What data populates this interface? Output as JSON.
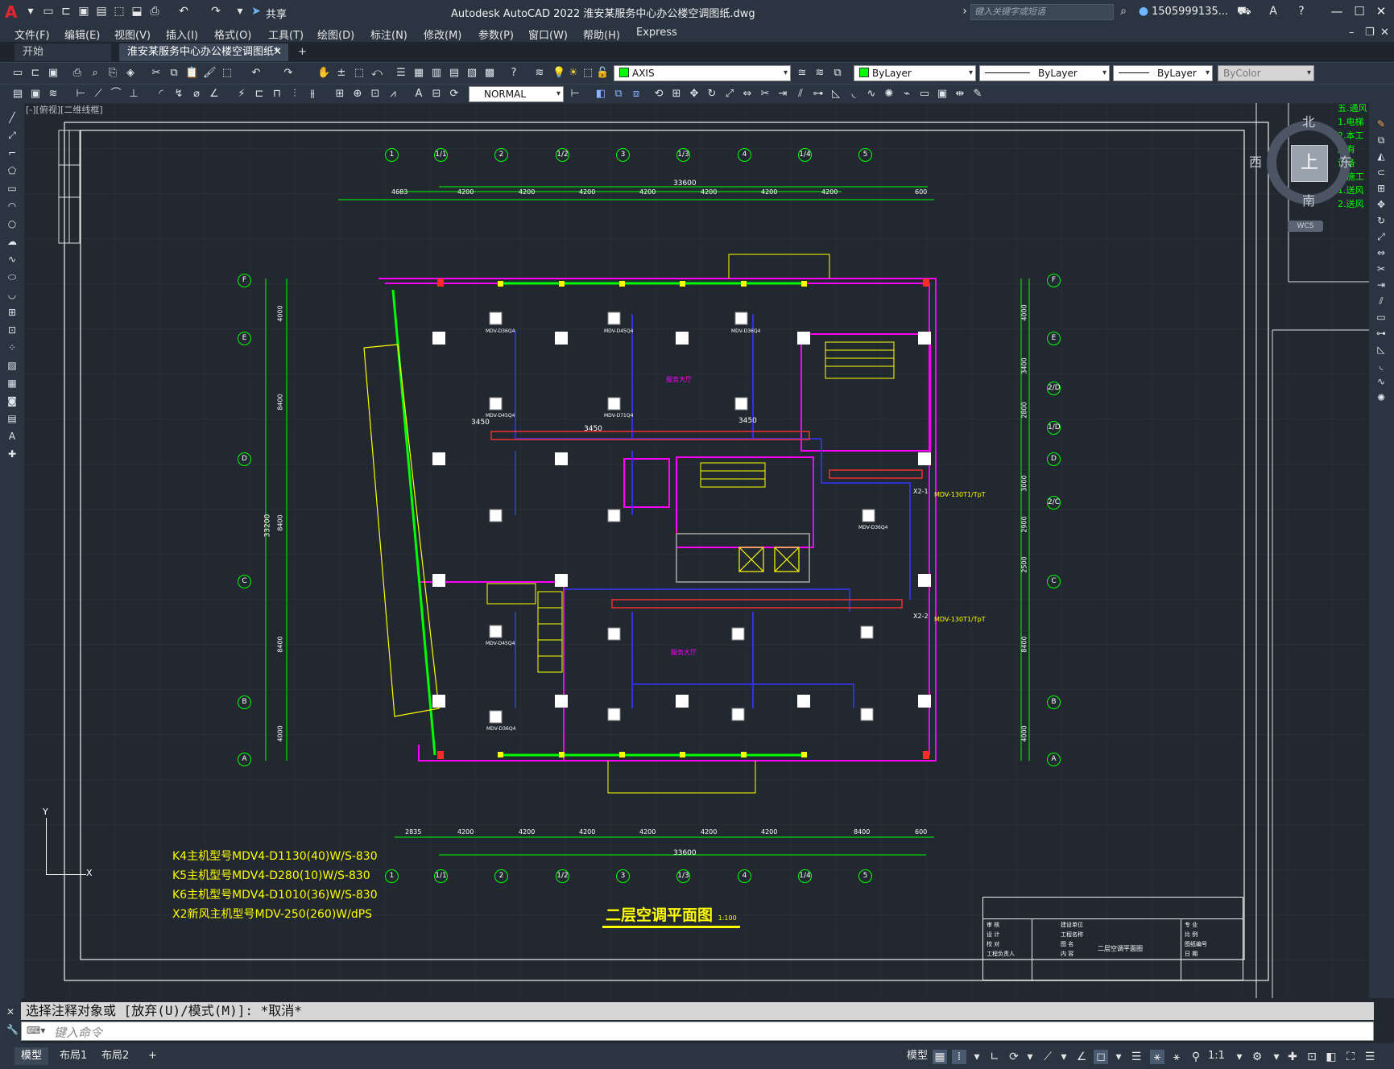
{
  "titlebar": {
    "app_letter": "A",
    "title": "Autodesk AutoCAD 2022    淮安某服务中心办公楼空调图纸.dwg",
    "share_label": "共享",
    "search_placeholder": "键入关键字或短语",
    "user": "1505999135...",
    "minimize": "—",
    "maximize": "☐",
    "close": "✕"
  },
  "menu": [
    "文件(F)",
    "编辑(E)",
    "视图(V)",
    "插入(I)",
    "格式(O)",
    "工具(T)",
    "绘图(D)",
    "标注(N)",
    "修改(M)",
    "参数(P)",
    "窗口(W)",
    "帮助(H)",
    "Express"
  ],
  "tabs": {
    "start": "开始",
    "active": "淮安某服务中心办公楼空调图纸*",
    "close": "✕",
    "add": "+"
  },
  "toolbar": {
    "layer": "AXIS",
    "color": "ByLayer",
    "linetype": "ByLayer",
    "lineweight": "ByLayer",
    "plotstyle": "ByColor",
    "dimstyle": "NORMAL"
  },
  "viewport_label": "[-][俯视][二维线框]",
  "drawing": {
    "grid_top": [
      "1",
      "1/1",
      "2",
      "1/2",
      "3",
      "1/3",
      "4",
      "1/4",
      "5"
    ],
    "grid_side_left": [
      "F",
      "E",
      "D",
      "C",
      "B",
      "A"
    ],
    "grid_side_right": [
      "F",
      "E",
      "2/D",
      "1/D",
      "D",
      "2/C",
      "C",
      "B",
      "A"
    ],
    "top_dims": [
      "4683",
      "4200",
      "4200",
      "4200",
      "4200",
      "4200",
      "4200",
      "4200",
      "600"
    ],
    "top_total": "33600",
    "bottom_dims": [
      "2835",
      "4200",
      "4200",
      "4200",
      "4200",
      "4200",
      "4200",
      "8400",
      "600"
    ],
    "bottom_total": "33600",
    "left_dims": [
      "4000",
      "8400",
      "8400",
      "8400",
      "4000"
    ],
    "left_total": "33200",
    "right_dims": [
      "4000",
      "3400",
      "2800",
      "3000",
      "2900",
      "2500",
      "8400",
      "4000"
    ],
    "notes": [
      "K4主机型号MDV4-D1130(40)W/S-830",
      "K5主机型号MDV4-D280(10)W/S-830",
      "K6主机型号MDV4-D1010(36)W/S-830",
      "X2新风主机型号MDV-250(260)W/dPS"
    ],
    "plan_title": "二层空调平面图",
    "plan_scale": "1:100",
    "unit_labels": [
      "MDV-D36Q4",
      "MDV-D45Q4",
      "MDV-D36Q4",
      "MDV-D45Q4",
      "MDV-D71Q4",
      "MDV-D36Q4",
      "MDV-D45Q4",
      "MDV-D36Q4"
    ],
    "room_labels": [
      "服务大厅",
      "服务大厅",
      "楼梯"
    ],
    "dims_inner": [
      "3450",
      "3450",
      "3450"
    ],
    "fresh_air": [
      "MDV-130T1/TpT",
      "MDV-130T1/TpT"
    ],
    "x_tags": [
      "X2-1",
      "X2-2"
    ],
    "title_block": {
      "rows": [
        "审 核",
        "设 计",
        "校 对",
        "工程负责人"
      ],
      "center": [
        "建设单位",
        "工程名称",
        "图 名",
        "内 容"
      ],
      "drawing_name": "二层空调平面图",
      "right": [
        "专 业",
        "比 例",
        "图纸编号",
        "日 期"
      ]
    }
  },
  "viewcube": {
    "north": "北",
    "south": "南",
    "east": "东",
    "west": "西",
    "top": "上",
    "wcs": "WCS"
  },
  "right_notes": [
    "五.通风",
    "1.电梯",
    "2.本工",
    "所有",
    "设备",
    "大施工",
    "1.送风",
    "2.送风"
  ],
  "command": {
    "history": "选择注释对象或 [放弃(U)/模式(M)]: *取消*",
    "placeholder": "键入命令"
  },
  "status": {
    "layouts": [
      "模型",
      "布局1",
      "布局2"
    ],
    "add": "+",
    "model": "模型",
    "scale": "1:1"
  },
  "colors": {
    "grid_green": "#00ff00",
    "wall_magenta": "#ff00ff",
    "duct_red": "#ff3030",
    "pipe_blue": "#2b2bff",
    "text_yellow": "#ffff00",
    "column_white": "#ffffff"
  }
}
